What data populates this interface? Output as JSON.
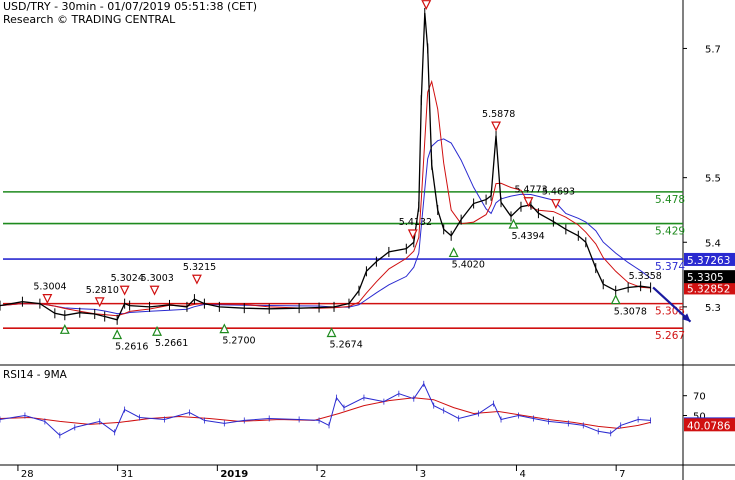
{
  "header": {
    "title": "USD/TRY - 30min - 01/07/2019 05:51:38 (CET)",
    "research": "Research © TRADING CENTRAL"
  },
  "chart_data": [
    {
      "type": "line",
      "panel": "price",
      "y_ticks": [
        5.3,
        5.4,
        5.5,
        5.7
      ],
      "y_tick_labels": [
        "5.3",
        "5.4",
        "5.5",
        "5.7"
      ],
      "x_date_labels": [
        "28",
        "31",
        "2019",
        "2",
        "3",
        "4",
        "7"
      ],
      "x_date_positions": [
        0.5,
        2.5,
        4.5,
        6.5,
        8.5,
        10.5,
        12.5
      ],
      "ylim": [
        5.21,
        5.775
      ],
      "xlim": [
        0,
        13.7
      ],
      "price_path": [
        [
          0,
          5.302
        ],
        [
          0.45,
          5.308
        ],
        [
          0.8,
          5.305
        ],
        [
          1.1,
          5.29
        ],
        [
          1.3,
          5.287
        ],
        [
          1.6,
          5.291
        ],
        [
          1.9,
          5.289
        ],
        [
          2.1,
          5.285
        ],
        [
          2.35,
          5.28
        ],
        [
          2.5,
          5.305
        ],
        [
          2.6,
          5.302
        ],
        [
          3,
          5.3
        ],
        [
          3.4,
          5.303
        ],
        [
          3.75,
          5.3
        ],
        [
          3.9,
          5.312
        ],
        [
          4.1,
          5.305
        ],
        [
          4.4,
          5.3
        ],
        [
          4.9,
          5.298
        ],
        [
          5.4,
          5.297
        ],
        [
          6.0,
          5.298
        ],
        [
          6.4,
          5.299
        ],
        [
          6.7,
          5.3
        ],
        [
          7.0,
          5.305
        ],
        [
          7.2,
          5.325
        ],
        [
          7.35,
          5.355
        ],
        [
          7.55,
          5.37
        ],
        [
          7.8,
          5.385
        ],
        [
          8.15,
          5.39
        ],
        [
          8.3,
          5.4
        ],
        [
          8.4,
          5.455
        ],
        [
          8.45,
          5.62
        ],
        [
          8.52,
          5.755
        ],
        [
          8.58,
          5.7
        ],
        [
          8.66,
          5.52
        ],
        [
          8.78,
          5.45
        ],
        [
          8.9,
          5.42
        ],
        [
          9.05,
          5.41
        ],
        [
          9.25,
          5.435
        ],
        [
          9.5,
          5.46
        ],
        [
          9.75,
          5.466
        ],
        [
          9.85,
          5.472
        ],
        [
          9.95,
          5.565
        ],
        [
          10.05,
          5.462
        ],
        [
          10.25,
          5.44
        ],
        [
          10.45,
          5.455
        ],
        [
          10.65,
          5.458
        ],
        [
          10.8,
          5.445
        ],
        [
          11.1,
          5.432
        ],
        [
          11.35,
          5.42
        ],
        [
          11.6,
          5.41
        ],
        [
          11.75,
          5.4
        ],
        [
          11.95,
          5.36
        ],
        [
          12.1,
          5.335
        ],
        [
          12.35,
          5.325
        ],
        [
          12.6,
          5.33
        ],
        [
          12.85,
          5.332
        ],
        [
          13.05,
          5.33
        ]
      ],
      "series": [],
      "levels": [
        {
          "value": 5.478,
          "label": "5.478",
          "color": "#1e8a1e"
        },
        {
          "value": 5.429,
          "label": "5.429",
          "color": "#1e8a1e"
        },
        {
          "value": 5.374,
          "label": "5.374",
          "color": "#2a2ad0"
        },
        {
          "value": 5.305,
          "label": "5.305",
          "color": "#d01010"
        },
        {
          "value": 5.267,
          "label": "5.267",
          "color": "#d01010"
        }
      ],
      "peaks": [
        {
          "x": 0.95,
          "y": 5.305,
          "label": "5.3004"
        },
        {
          "x": 2.0,
          "y": 5.3,
          "label": "5.2810"
        },
        {
          "x": 2.5,
          "y": 5.318,
          "label": "5.3024"
        },
        {
          "x": 3.1,
          "y": 5.318,
          "label": "5.3003"
        },
        {
          "x": 3.95,
          "y": 5.335,
          "label": "5.3215"
        },
        {
          "x": 8.28,
          "y": 5.405,
          "label": "5.4132"
        },
        {
          "x": 9.95,
          "y": 5.572,
          "label": "5.5878"
        },
        {
          "x": 10.6,
          "y": 5.455,
          "label": "5.4773"
        },
        {
          "x": 11.15,
          "y": 5.452,
          "label": "5.4693"
        },
        {
          "x": 8.55,
          "y": 5.76,
          "label": ""
        }
      ],
      "troughs": [
        {
          "x": 1.3,
          "y": 5.273,
          "label": ""
        },
        {
          "x": 2.35,
          "y": 5.265,
          "label": "5.2616"
        },
        {
          "x": 3.15,
          "y": 5.27,
          "label": "5.2661"
        },
        {
          "x": 4.5,
          "y": 5.274,
          "label": "5.2700"
        },
        {
          "x": 6.65,
          "y": 5.268,
          "label": "5.2674"
        },
        {
          "x": 9.1,
          "y": 5.392,
          "label": "5.4020"
        },
        {
          "x": 10.3,
          "y": 5.436,
          "label": "5.4394"
        },
        {
          "x": 12.35,
          "y": 5.319,
          "label": "5.3078"
        }
      ],
      "note_label": {
        "x": 13.05,
        "y": 5.337,
        "label": "5.3358"
      },
      "current_price": {
        "value": 5.3305,
        "label": "5.3305",
        "color": "#000000"
      },
      "price_tags": [
        {
          "value": 5.37263,
          "label": "5.37263",
          "color": "#2a2ad0"
        },
        {
          "value": 5.32852,
          "label": "5.32852",
          "color": "#d01010"
        }
      ],
      "projection": {
        "from": [
          13.1,
          5.33
        ],
        "to": [
          13.85,
          5.277
        ],
        "color": "#1a1aa0"
      }
    },
    {
      "type": "line",
      "panel": "rsi",
      "title": "RSI14 - 9MA",
      "ylim": [
        0,
        100
      ],
      "y_ticks": [
        70,
        50
      ],
      "y_tick_labels": [
        "70",
        "50"
      ],
      "rsi_path": [
        [
          0,
          46
        ],
        [
          0.5,
          50
        ],
        [
          0.9,
          44
        ],
        [
          1.2,
          30
        ],
        [
          1.5,
          38
        ],
        [
          2.0,
          44
        ],
        [
          2.3,
          33
        ],
        [
          2.5,
          56
        ],
        [
          2.8,
          48
        ],
        [
          3.3,
          46
        ],
        [
          3.8,
          53
        ],
        [
          4.1,
          45
        ],
        [
          4.5,
          42
        ],
        [
          4.9,
          45
        ],
        [
          5.4,
          47
        ],
        [
          6.0,
          46
        ],
        [
          6.4,
          45
        ],
        [
          6.6,
          40
        ],
        [
          6.75,
          68
        ],
        [
          6.9,
          58
        ],
        [
          7.3,
          68
        ],
        [
          7.7,
          64
        ],
        [
          8.0,
          72
        ],
        [
          8.3,
          67
        ],
        [
          8.5,
          82
        ],
        [
          8.7,
          60
        ],
        [
          8.9,
          55
        ],
        [
          9.2,
          47
        ],
        [
          9.6,
          52
        ],
        [
          9.9,
          62
        ],
        [
          10.05,
          46
        ],
        [
          10.4,
          50
        ],
        [
          10.7,
          47
        ],
        [
          11.0,
          44
        ],
        [
          11.4,
          42
        ],
        [
          11.7,
          40
        ],
        [
          12.0,
          34
        ],
        [
          12.25,
          32
        ],
        [
          12.45,
          40
        ],
        [
          12.8,
          46
        ],
        [
          13.05,
          45
        ]
      ],
      "ma_path": [
        [
          0,
          47
        ],
        [
          0.6,
          48
        ],
        [
          1.2,
          44
        ],
        [
          1.8,
          41
        ],
        [
          2.4,
          43
        ],
        [
          3.0,
          47
        ],
        [
          3.6,
          49
        ],
        [
          4.2,
          47
        ],
        [
          4.8,
          44
        ],
        [
          5.6,
          46
        ],
        [
          6.3,
          45
        ],
        [
          6.8,
          52
        ],
        [
          7.3,
          60
        ],
        [
          7.8,
          65
        ],
        [
          8.3,
          68
        ],
        [
          8.7,
          66
        ],
        [
          9.1,
          58
        ],
        [
          9.5,
          52
        ],
        [
          10.0,
          54
        ],
        [
          10.5,
          50
        ],
        [
          11.0,
          46
        ],
        [
          11.5,
          43
        ],
        [
          12.0,
          39
        ],
        [
          12.4,
          37
        ],
        [
          12.8,
          40
        ],
        [
          13.05,
          43
        ]
      ],
      "series": [],
      "price_tags": [
        {
          "value": 41.0249,
          "label": "41.0249",
          "color": "#2a2ad0"
        },
        {
          "value": 40.0786,
          "label": "40.0786",
          "color": "#d01010"
        }
      ]
    }
  ],
  "colors": {
    "price": "#000000",
    "ma_red": "#d01010",
    "ma_blue": "#2a2ad0",
    "green": "#1e8a1e",
    "marker_red": "#d01010",
    "marker_green": "#1e8a1e"
  }
}
